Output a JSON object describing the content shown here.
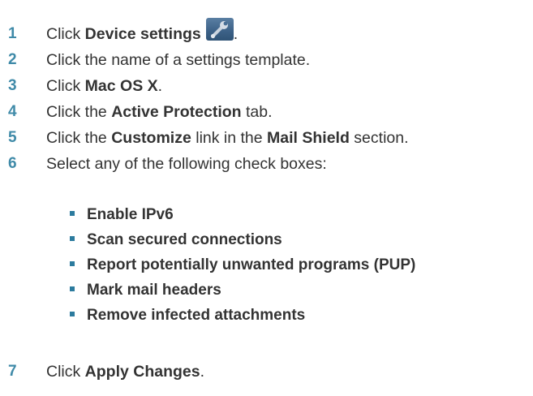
{
  "steps": [
    {
      "number": "1",
      "pre": "Click ",
      "bold": "Device settings",
      "post": "."
    },
    {
      "number": "2",
      "text": "Click the name of a settings template."
    },
    {
      "number": "3",
      "pre": "Click ",
      "bold": "Mac OS X",
      "post": "."
    },
    {
      "number": "4",
      "pre": "Click the ",
      "bold": "Active Protection",
      "post": " tab."
    },
    {
      "number": "5",
      "pre": "Click the ",
      "bold": "Customize",
      "mid": " link in the ",
      "bold2": "Mail Shield",
      "post": " section."
    },
    {
      "number": "6",
      "text": "Select any of the following check boxes:"
    },
    {
      "number": "7",
      "pre": "Click ",
      "bold": "Apply Changes",
      "post": "."
    }
  ],
  "checkboxes": [
    "Enable IPv6",
    "Scan secured connections",
    "Report potentially unwanted programs (PUP)",
    "Mark mail headers",
    "Remove infected attachments"
  ],
  "icons": {
    "device_settings": "wrench-icon"
  },
  "colors": {
    "step_number": "#3f8aa8",
    "bullet": "#2c7b9e",
    "text": "#333333"
  }
}
